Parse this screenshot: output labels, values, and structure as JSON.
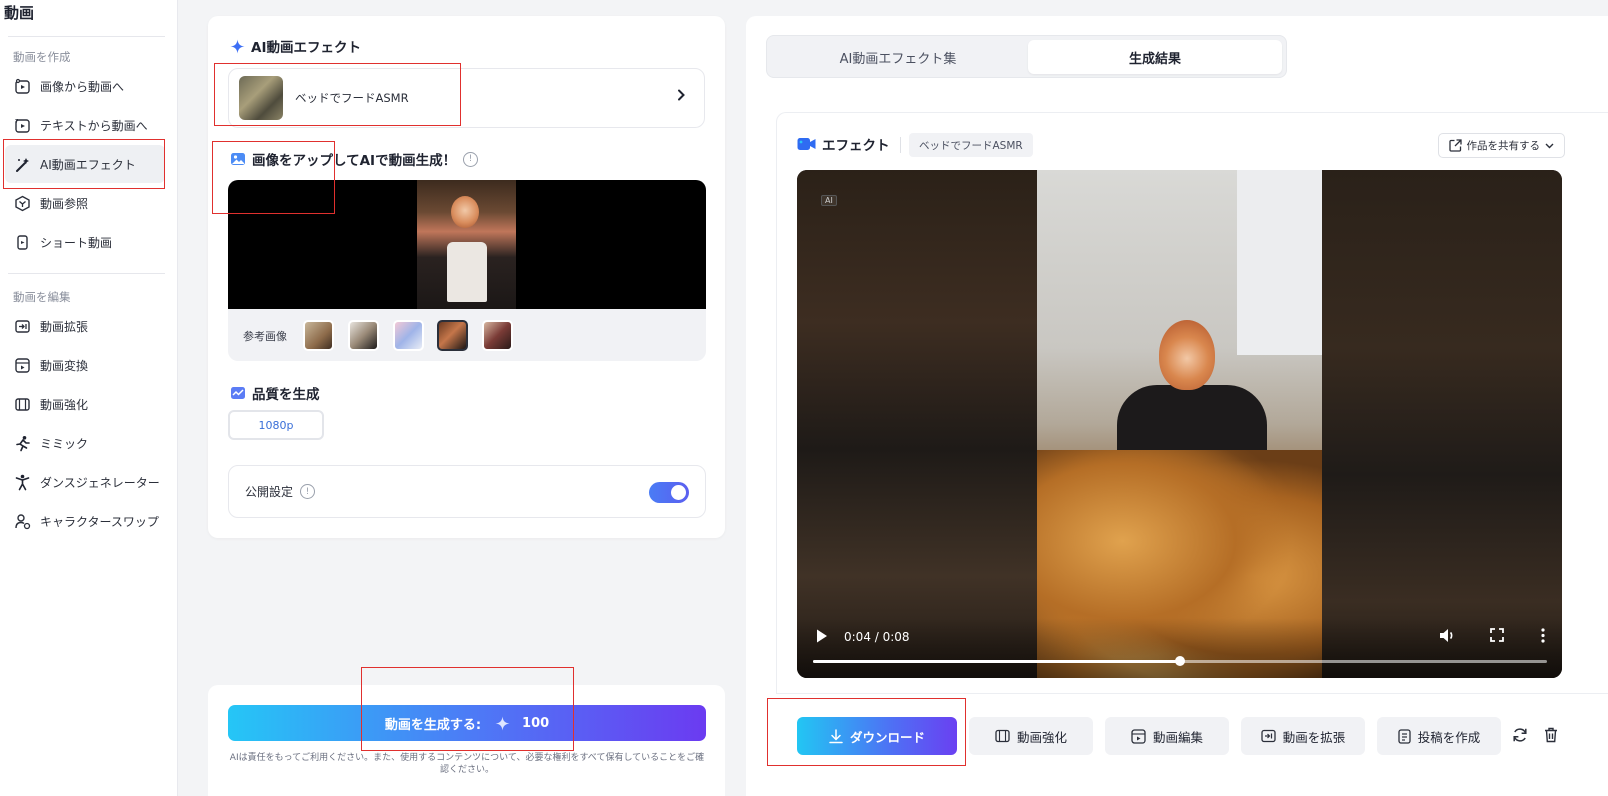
{
  "sidebar": {
    "title": "動画",
    "create_section": "動画を作成",
    "edit_section": "動画を編集",
    "create_items": [
      {
        "label": "画像から動画へ",
        "icon": "image-to-video-icon"
      },
      {
        "label": "テキストから動画へ",
        "icon": "text-to-video-icon"
      },
      {
        "label": "AI動画エフェクト",
        "icon": "magic-wand-icon",
        "active": true
      },
      {
        "label": "動画参照",
        "icon": "hexagon-reference-icon"
      },
      {
        "label": "ショート動画",
        "icon": "short-video-icon"
      }
    ],
    "edit_items": [
      {
        "label": "動画拡張",
        "icon": "video-extend-icon"
      },
      {
        "label": "動画変換",
        "icon": "video-convert-icon"
      },
      {
        "label": "動画強化",
        "icon": "video-enhance-icon"
      },
      {
        "label": "ミミック",
        "icon": "running-figure-icon"
      },
      {
        "label": "ダンスジェネレーター",
        "icon": "dance-figure-icon"
      },
      {
        "label": "キャラクタースワップ",
        "icon": "character-swap-icon"
      }
    ]
  },
  "left": {
    "effect_title": "AI動画エフェクト",
    "effect_name": "ベッドでフードASMR",
    "upload_title": "画像をアップしてAIで動画生成！",
    "ref_label": "参考画像",
    "quality_title": "品質を生成",
    "quality_value": "1080p",
    "public_label": "公開設定",
    "public_on": true,
    "generate_label": "動画を生成する:",
    "generate_cost": "100",
    "disclaimer": "AIは責任をもってご利用ください。また、使用するコンテンツについて、必要な権利をすべて保有していることをご確認ください。"
  },
  "right": {
    "tabs": [
      "AI動画エフェクト集",
      "生成結果"
    ],
    "active_tab": 1,
    "effect_label": "エフェクト",
    "effect_chip": "ベッドでフードASMR",
    "share_label": "作品を共有する",
    "video": {
      "ai_badge": "AI",
      "time": "0:04 / 0:08",
      "progress": 0.5
    },
    "actions": {
      "download": "ダウンロード",
      "enhance": "動画強化",
      "edit": "動画編集",
      "extend": "動画を拡張",
      "post": "投稿を作成"
    }
  },
  "colors": {
    "accent_blue": "#4c7cf6",
    "accent_purple": "#6b3bf1",
    "accent_cyan": "#25c6f6",
    "highlight_red": "#e0302e"
  }
}
